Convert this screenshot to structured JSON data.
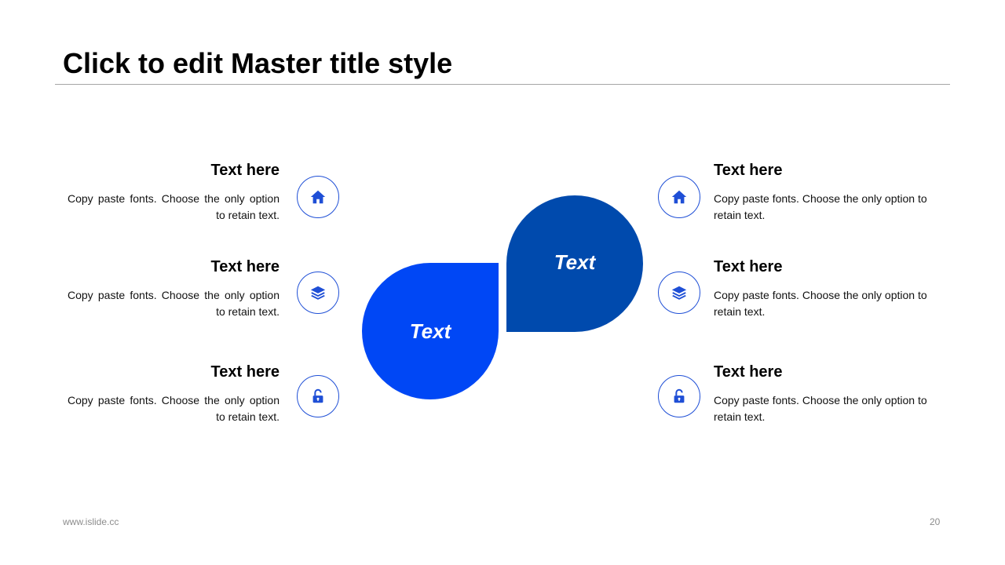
{
  "title": "Click to edit Master title style",
  "petals": [
    "Text",
    "Text"
  ],
  "left_items": [
    {
      "heading": "Text here",
      "body": "Copy paste fonts. Choose the only option to retain text.",
      "icon": "home-icon"
    },
    {
      "heading": "Text here",
      "body": "Copy paste fonts. Choose the only option to retain text.",
      "icon": "layers-icon"
    },
    {
      "heading": "Text here",
      "body": "Copy paste fonts. Choose the only option to retain text.",
      "icon": "unlock-icon"
    }
  ],
  "right_items": [
    {
      "heading": "Text here",
      "body": "Copy paste fonts. Choose the only option to retain text.",
      "icon": "home-icon"
    },
    {
      "heading": "Text here",
      "body": "Copy paste fonts. Choose the only option to retain text.",
      "icon": "layers-icon"
    },
    {
      "heading": "Text here",
      "body": "Copy paste fonts. Choose the only option to retain text.",
      "icon": "unlock-icon"
    }
  ],
  "footer": {
    "url": "www.islide.cc",
    "page": "20"
  },
  "colors": {
    "accent_light": "#0047f5",
    "accent_dark": "#004aad",
    "icon_stroke": "#1f4fd6"
  }
}
